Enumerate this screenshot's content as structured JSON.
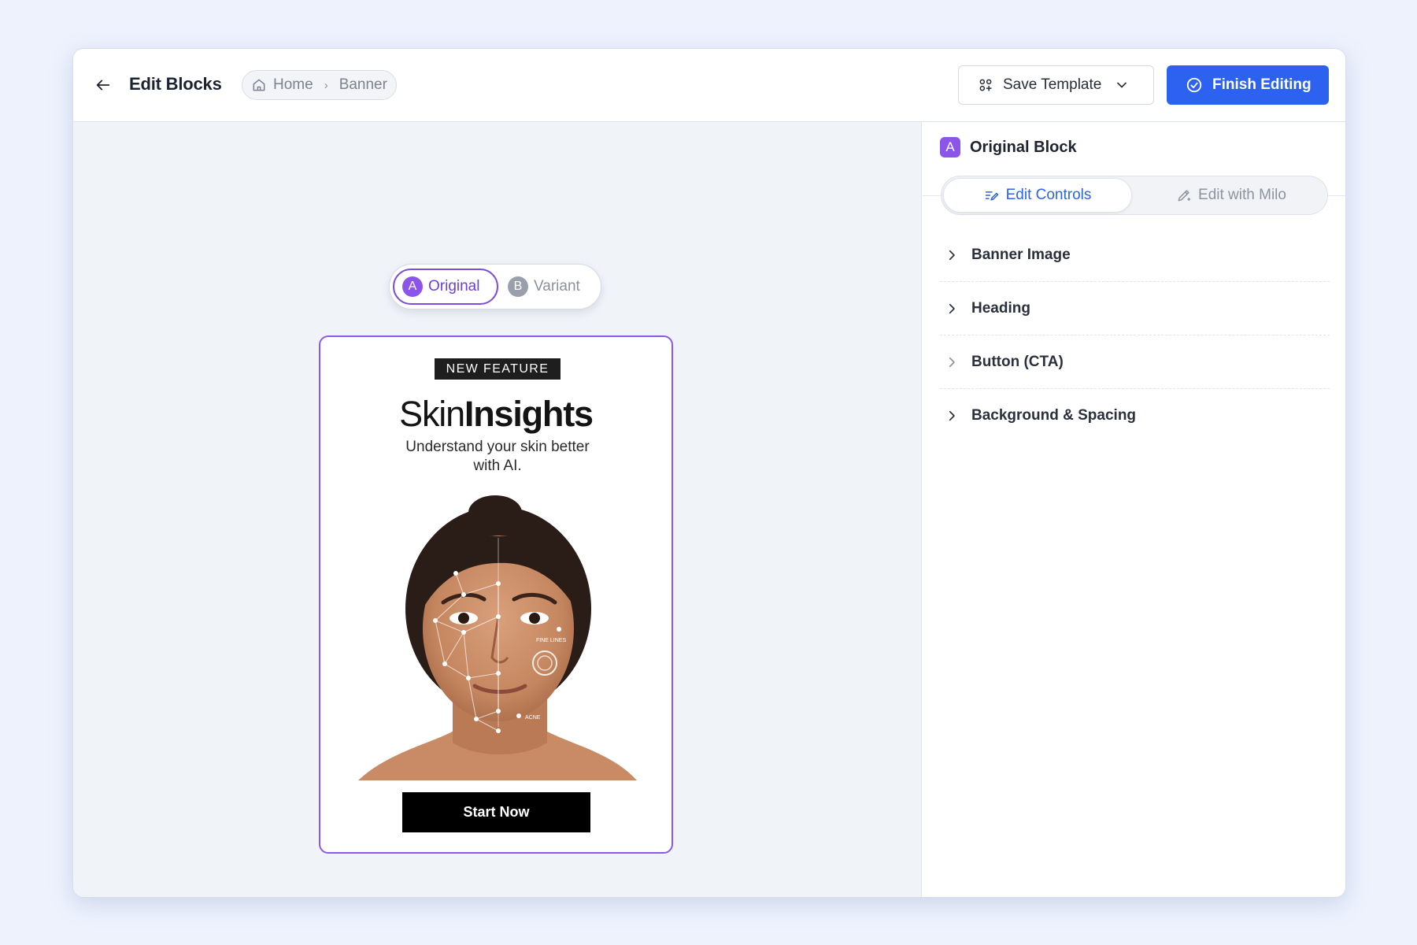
{
  "header": {
    "title": "Edit Blocks",
    "breadcrumb": [
      "Home",
      "Banner"
    ],
    "save_label": "Save Template",
    "finish_label": "Finish Editing"
  },
  "canvas": {
    "variant_toggle": [
      {
        "badge": "A",
        "label": "Original",
        "active": true
      },
      {
        "badge": "B",
        "label": "Variant",
        "active": false
      }
    ],
    "banner": {
      "tag": "NEW FEATURE",
      "heading_light": "Skin",
      "heading_bold": "Insights",
      "subtitle": "Understand your skin better with AI.",
      "image_labels": [
        "FINE LINES",
        "ACNE"
      ],
      "cta": "Start Now"
    }
  },
  "panel": {
    "badge": "A",
    "title": "Original Block",
    "tabs": [
      {
        "label": "Edit Controls",
        "active": true
      },
      {
        "label": "Edit with Milo",
        "active": false
      }
    ],
    "sections": [
      "Banner Image",
      "Heading",
      "Button (CTA)",
      "Background & Spacing"
    ]
  },
  "colors": {
    "accent": "#2c62ef",
    "variant_purple": "#8b55e9",
    "background": "#edf2fd"
  },
  "icons": {
    "back": "arrow-left-icon",
    "home": "home-icon",
    "save": "template-grid-icon",
    "dropdown": "chevron-down-icon",
    "finish": "check-circle-icon",
    "edit_controls": "sliders-pen-icon",
    "edit_milo": "magic-pen-icon",
    "section": "chevron-right-icon"
  }
}
